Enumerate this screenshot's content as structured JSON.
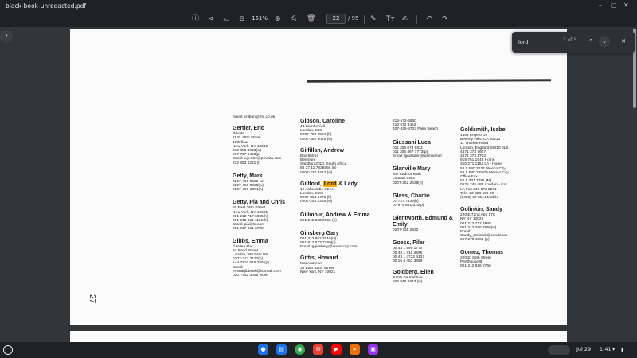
{
  "window": {
    "title": "black-book-unredacted.pdf",
    "controls": [
      "–",
      "▢",
      "✕"
    ]
  },
  "toolbar": {
    "zoom": "151%",
    "page_current": "22",
    "page_total": "/ 95"
  },
  "find": {
    "query": "lord",
    "count": "3 of 5"
  },
  "document": {
    "page_number": "27",
    "col1": [
      {
        "name": "",
        "lines": [
          "Email: crilbon@pfd.co.uk"
        ]
      },
      {
        "name": "Gertler, Eric",
        "lines": [
          "Private",
          "11 E. 26th Street",
          "18th floor",
          "New York, NY 10010",
          "212 653 8033(w)",
          "917 797 6488(p)",
          "Email: egertler@privista.com",
          "212 653 6221 (f)"
        ]
      },
      {
        "name": "Getty, Mark",
        "lines": [
          "0207-486 0660 (w)",
          "0207-486 0668(w)",
          "0207-401-8881(h)"
        ]
      },
      {
        "name": "Getty, Pia and Chris",
        "lines": [
          "20 East 76th Street",
          "New York, NY 10021",
          "001 212 717 6985(h)",
          "001 212 861 1121(h)",
          "Email: pia@ld.com",
          "001 917 921 6788"
        ]
      },
      {
        "name": "Gibbs, Emma",
        "lines": [
          "Garden Flat",
          "91 Bond Street",
          "London, W8 5AU UK",
          "0207-313 2177(h)",
          "+44 7710 016 355 (p)",
          "Email:",
          "emmagibbsuk@hotmail.com",
          "0207-352 3045 work"
        ]
      }
    ],
    "col2": [
      {
        "name": "Gibson, Caroline",
        "lines": [
          "43 Cambervell",
          "London, SE5",
          "0207-703 0574 (h)",
          "0207-352 9044 (w)"
        ]
      },
      {
        "name": "Gilfillan, Andrew",
        "lines": [
          "Box 65014",
          "Benmore",
          "Sandton 2010, South Africa",
          "88 27 11 7836858 (p)",
          "0207-720 3412 (w)"
        ]
      },
      {
        "name_before": "Gillford, ",
        "name_highlight": "Lord",
        "name_after": " & Lady",
        "lines": [
          "12 Ashcombe Street",
          "London, SW6",
          "0207-384 1776 (h)",
          "0207-245 1245 (w)"
        ]
      },
      {
        "name": "Gillmour, Andrew & Emma",
        "lines": [
          "001 212 533 0656 (h)"
        ]
      },
      {
        "name": "Ginsberg Gary",
        "lines": [
          "001 212 852 7018(w)",
          "001 917 673 7459(p)",
          "Email: gginsberg@newscorp.com"
        ]
      },
      {
        "name": "Gittis, Howard",
        "lines": [
          "MacAndrews",
          "35 East 62nd Street",
          "New York, NY 10021"
        ]
      }
    ],
    "col3": [
      {
        "name": "",
        "lines": [
          "212-572-6960",
          "212 572 4452",
          "407-835-8703 Palm Beach"
        ]
      },
      {
        "name": "Giussani Luca",
        "lines": [
          "011 305 673 9811",
          "011 305 467 7773(p)",
          "Email: lgiussani@hotmail.net"
        ]
      },
      {
        "name": "Glanville Mary",
        "lines": [
          "Ste Radnor Walk",
          "London SW3",
          "0207-352 2438(h)"
        ]
      },
      {
        "name": "Glass, Charlie",
        "lines": [
          "07 727 7839(h)",
          "07 979 881 510(p)"
        ]
      },
      {
        "name": "Glentworth, Edmund & Emily",
        "lines": [
          "0207-735 2832 (",
          ""
        ]
      },
      {
        "name": "Goess, Pilar",
        "lines": [
          "00 43 1 595 1770",
          "00 43 1 715 4695",
          "00 43 1 4722 4137",
          "00 16 4 453 3698"
        ]
      },
      {
        "name": "Goldberg, Ellen",
        "lines": [
          "Santa Fe Institute",
          "505 946 2643 (w)"
        ]
      }
    ],
    "col4": [
      {
        "name": "Goldsmith, Isabel",
        "lines": [
          "1362 Angelo Dr",
          "Beverly Hills, CA 90210",
          "11 Thurloe Road",
          "London, England SW10 9LS",
          "4471 373 7607",
          "4471 373 1702",
          "818 761 1048 Home",
          "310 271 1162 LA - Home",
          "52 5 540 7037 Mexico City",
          "52 5 540 7658/9 Mexico City -",
          "Office Fax",
          "52 5 337 3781 (M)",
          "0525 245 485 London - Car",
          "LA Fax 310 271 5271",
          "Tele. 52 328 506 00",
          "(0488) 90 8514 Mobile"
        ]
      },
      {
        "name": "Golinkin, Sandy",
        "lines": [
          "220 E 72nd Apt. 17C",
          "NY NY 10021",
          "001 212 772 3948",
          "001 212 286 7666(w)",
          "Email:",
          "Sandy_Golinkin@condenas",
          "917 270 4602 (p)"
        ]
      },
      {
        "name": "Gomez, Thomas",
        "lines": [
          "220 E. 65th Street",
          "Penthouse B",
          "001 212 926 2766"
        ]
      }
    ]
  },
  "shelf": {
    "date": "Jul 29",
    "time": "1:41"
  }
}
